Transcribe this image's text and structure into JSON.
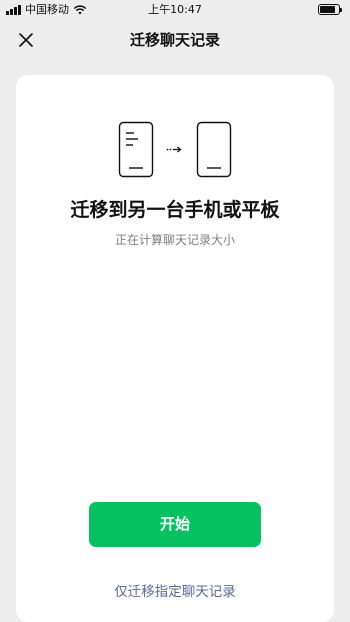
{
  "status_bar": {
    "carrier": "中国移动",
    "time": "上午10:47",
    "battery_level": 0.85,
    "icons": [
      "signal-icon",
      "wifi-icon",
      "battery-icon"
    ]
  },
  "nav": {
    "title": "迁移聊天记录",
    "close_icon": "close-icon"
  },
  "card": {
    "illustration_icons": [
      "phone-icon",
      "arrow-right-icon",
      "phone-icon"
    ],
    "title": "迁移到另一台手机或平板",
    "subtitle": "正在计算聊天记录大小",
    "start_button": "开始",
    "select_link": "仅迁移指定聊天记录"
  },
  "colors": {
    "accent": "#07c160",
    "link": "#576b95",
    "background": "#ededed"
  }
}
